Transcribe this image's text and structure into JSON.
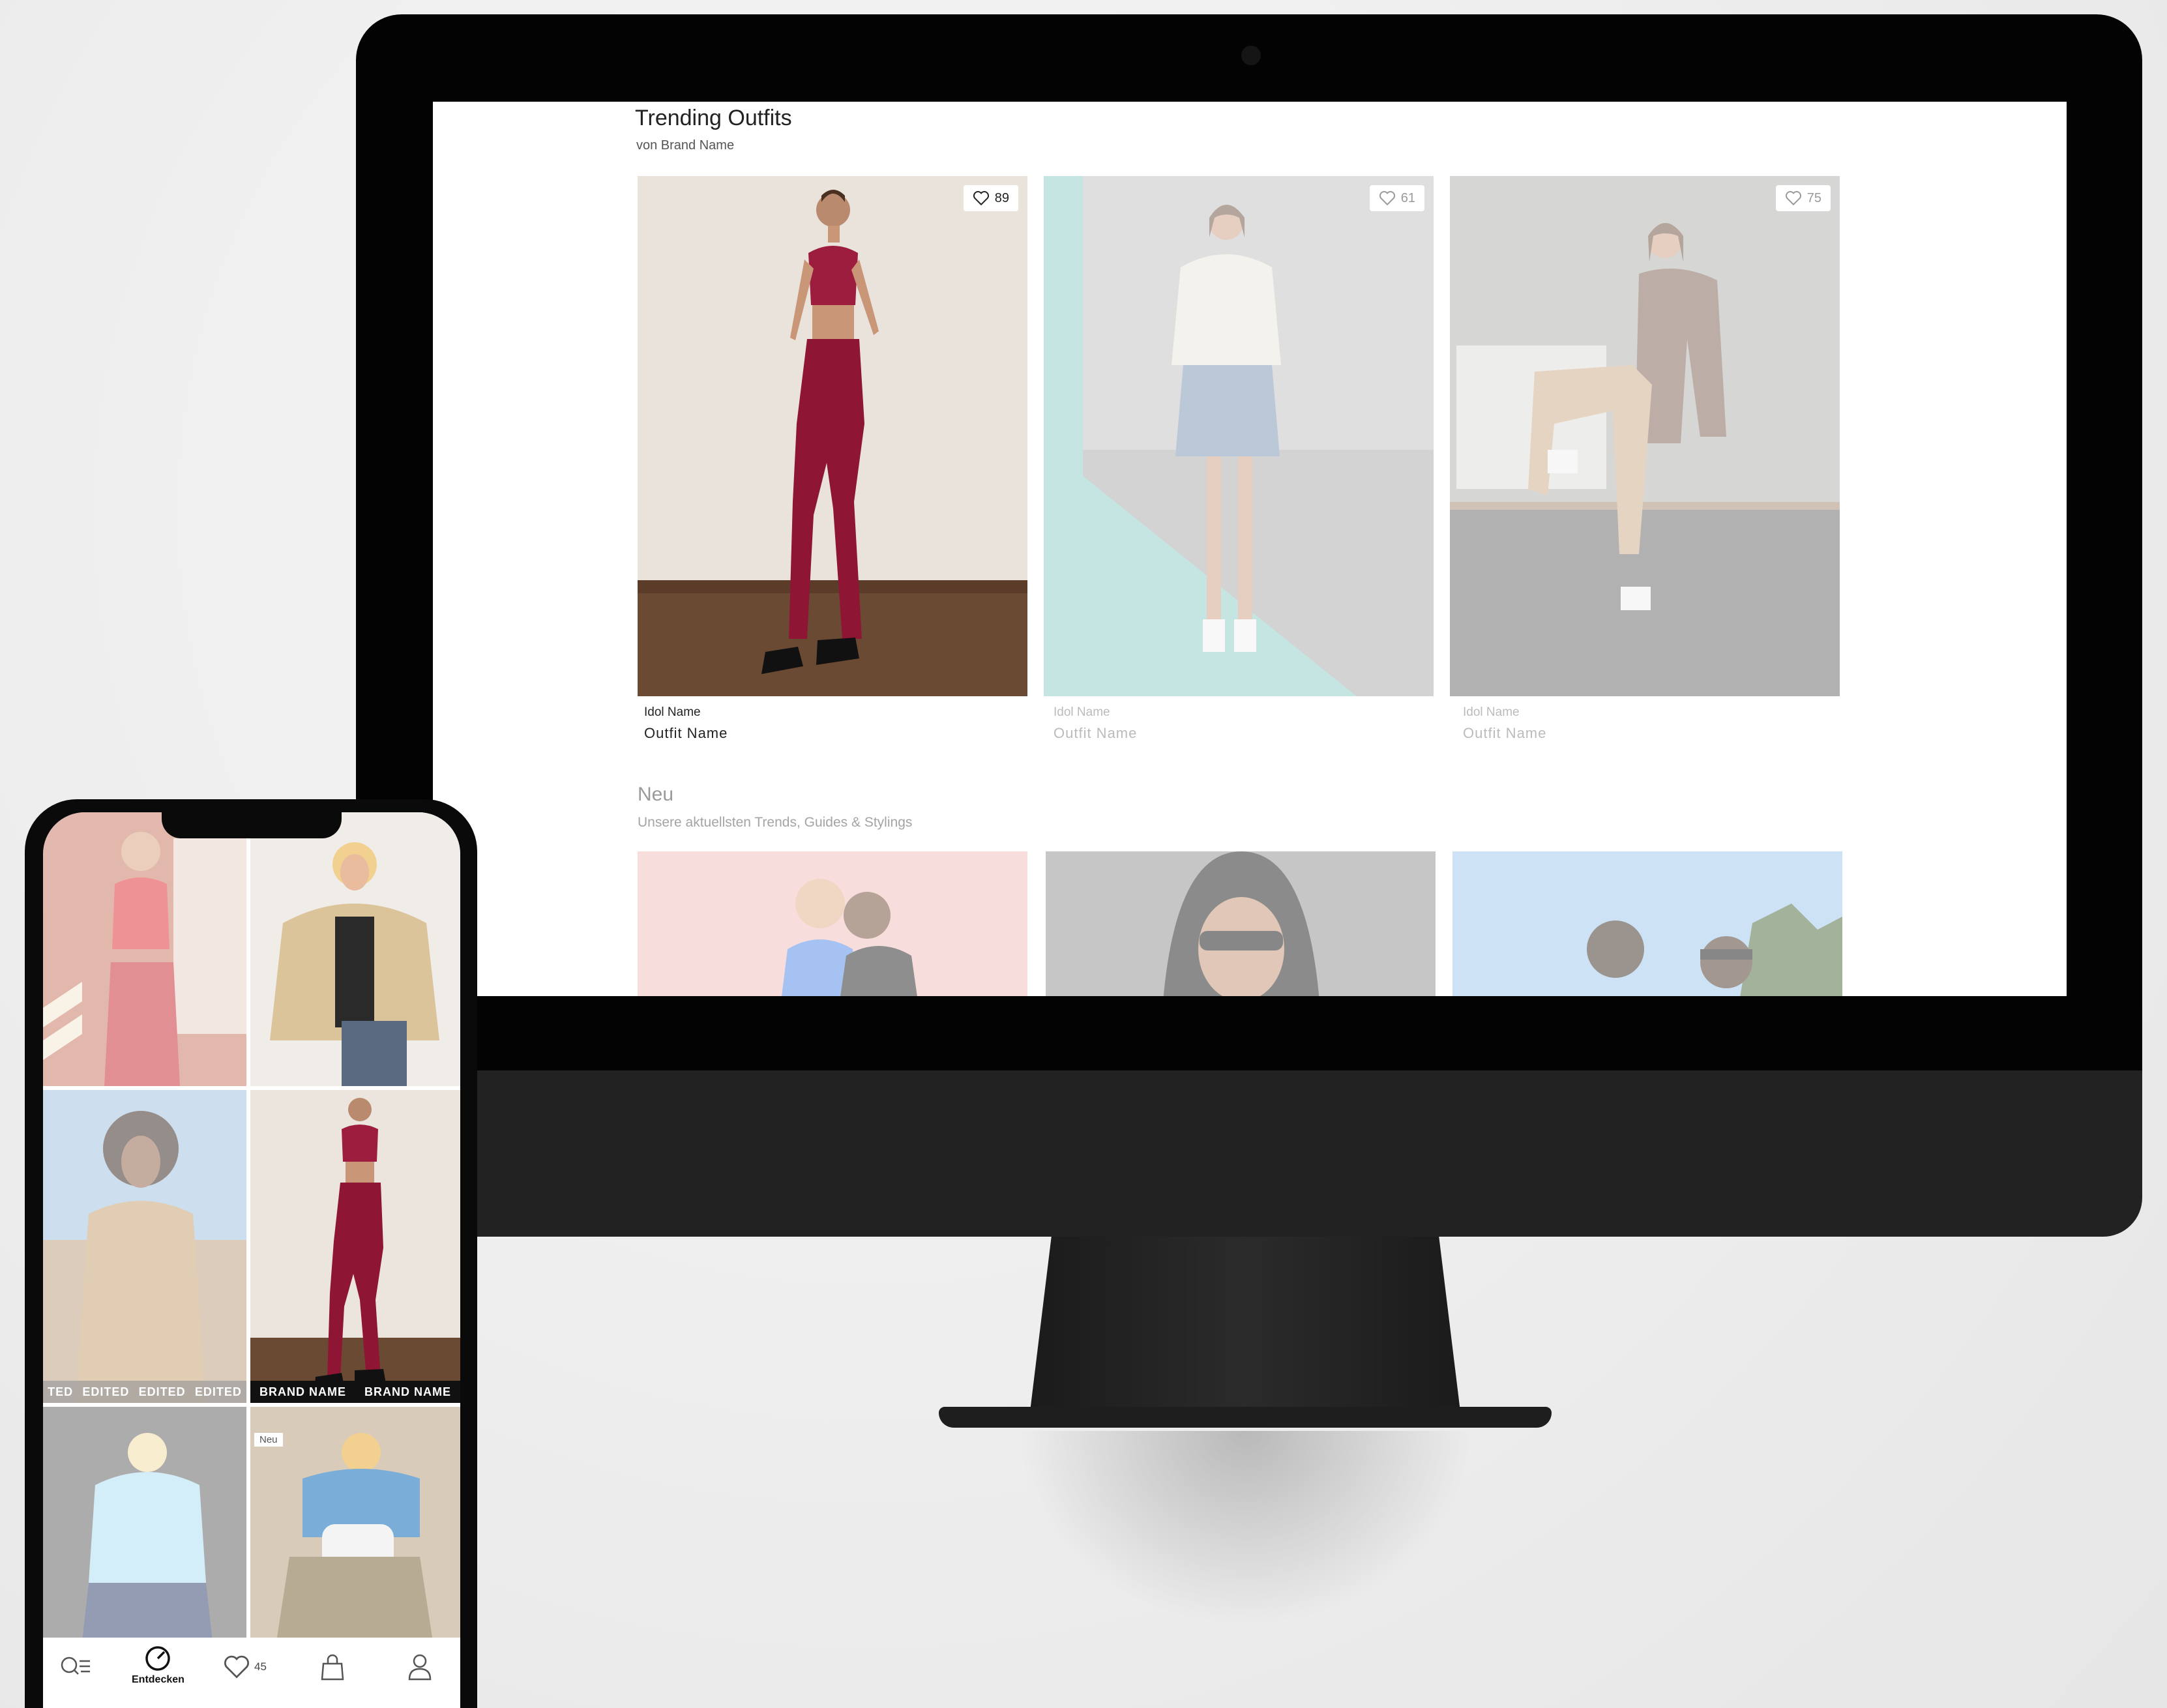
{
  "desktop": {
    "trending": {
      "title": "Trending Outfits",
      "subtitle": "von Brand Name",
      "cards": [
        {
          "likes": "89",
          "idol": "Idol Name",
          "outfit": "Outfit Name",
          "active": true
        },
        {
          "likes": "61",
          "idol": "Idol Name",
          "outfit": "Outfit Name",
          "active": false
        },
        {
          "likes": "75",
          "idol": "Idol Name",
          "outfit": "Outfit Name",
          "active": false
        }
      ]
    },
    "new_section": {
      "title": "Neu",
      "subtitle": "Unsere aktuellsten Trends, Guides & Stylings"
    }
  },
  "phone": {
    "feed": {
      "edited_labels": [
        "TED",
        "EDITED",
        "EDITED",
        "EDITED"
      ],
      "brand_labels": [
        "BRAND NAME",
        "BRAND NAME"
      ],
      "neu_badge": "Neu"
    },
    "tab_bar": {
      "search": {
        "icon": "search-list-icon"
      },
      "discover": {
        "icon": "compass-icon",
        "label": "Entdecken"
      },
      "favorites": {
        "icon": "heart-icon",
        "count": "45"
      },
      "bag": {
        "icon": "shopping-bag-icon"
      },
      "profile": {
        "icon": "user-icon"
      }
    }
  }
}
